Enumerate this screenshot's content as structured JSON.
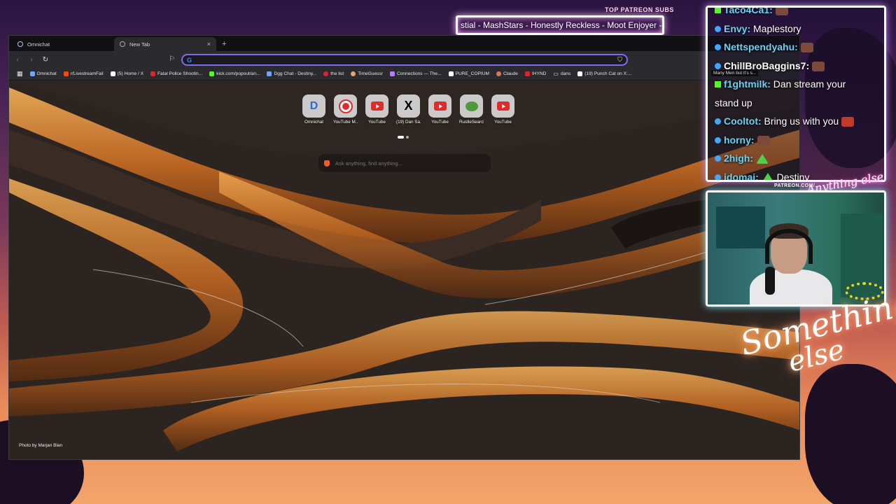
{
  "overlay": {
    "patreon_title": "TOP PATREON SUBS",
    "ticker_text": "stial - MashStars - Honestly Reckless - Moot Enjoyer - Roa",
    "patreon_url": "PATREON.COM/",
    "anything_else": "Anything else",
    "neon_line1": "Something",
    "neon_line2": "else"
  },
  "browser": {
    "tabs": [
      {
        "label": "Omnichat",
        "active": false
      },
      {
        "label": "New Tab",
        "active": true
      }
    ],
    "close_glyph": "×",
    "newtab_glyph": "+",
    "address_value": "",
    "bookmarks": [
      {
        "label": "Omnichat",
        "icon_color": "#6aa8ff"
      },
      {
        "label": "r/LivestreamFail",
        "icon_color": "#ff4500"
      },
      {
        "label": "(5) Home / X",
        "icon_color": "#ffffff"
      },
      {
        "label": "Fatal Police Shootin...",
        "icon_color": "#e0242c"
      },
      {
        "label": "kick.com/popout/an...",
        "icon_color": "#53fc18"
      },
      {
        "label": "Dgg Chat - Destiny...",
        "icon_color": "#6aa8ff"
      },
      {
        "label": "the list",
        "icon_color": "#e0242c"
      },
      {
        "label": "TimeGuessr",
        "icon_color": "#e8a46a"
      },
      {
        "label": "Connections — The...",
        "icon_color": "#b57bff"
      },
      {
        "label": "PURE_COPIUM",
        "icon_color": "#ffffff"
      },
      {
        "label": "Claude",
        "icon_color": "#d97757"
      },
      {
        "label": "IHYND",
        "icon_color": "#e0242c"
      },
      {
        "label": "dans",
        "icon_color": "#cccccc"
      },
      {
        "label": "(19) Punch Cat on X:...",
        "icon_color": "#ffffff"
      }
    ],
    "shortcuts": [
      {
        "label": "Omnichat",
        "icon": "omnichat-icon"
      },
      {
        "label": "YouTube M...",
        "icon": "youtube-music-icon"
      },
      {
        "label": "YouTube",
        "icon": "youtube-icon"
      },
      {
        "label": "(19) Dan Sa...",
        "icon": "x-icon"
      },
      {
        "label": "YouTube",
        "icon": "youtube-icon"
      },
      {
        "label": "RustleSearch",
        "icon": "pepe-icon"
      },
      {
        "label": "YouTube",
        "icon": "youtube-icon"
      }
    ],
    "search_placeholder": "Ask anything, find anything...",
    "photo_credit": "Photo by Marjan Blan"
  },
  "chat": {
    "messages": [
      {
        "user": "Taco4Ca1:",
        "text": "",
        "badge": "kick"
      },
      {
        "user": "Envy:",
        "text": "Maplestory",
        "badge": "dgg"
      },
      {
        "user": "Nettspendyahu:",
        "text": "",
        "badge": "dgg"
      },
      {
        "user": "ChillBroBaggins7:",
        "text": "",
        "badge": "dgg"
      },
      {
        "user": "f1ghtmilk:",
        "text": "Dan stream your",
        "badge": "kick"
      },
      {
        "user": "",
        "text": "stand up",
        "badge": ""
      },
      {
        "user": "Cooltot:",
        "text": "Bring us with you",
        "badge": "dgg"
      },
      {
        "user": "horny:",
        "text": "",
        "badge": "dgg"
      },
      {
        "user": "2high:",
        "text": "",
        "badge": "dgg"
      },
      {
        "user": "idomai:",
        "text": "Destiny",
        "badge": "dgg"
      }
    ],
    "popup_text": "Many Men but it's s..."
  }
}
